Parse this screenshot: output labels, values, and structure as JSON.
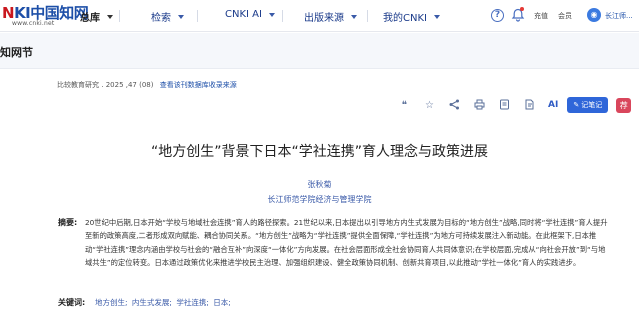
{
  "header": {
    "logo_text": "中国知网",
    "logo_url": "www.cnki.net",
    "zongku_label": "总库",
    "nav": [
      {
        "label": "检索"
      },
      {
        "label": "CNKI AI"
      },
      {
        "label": "出版来源"
      },
      {
        "label": "我的CNKI"
      }
    ],
    "recharge": "充值",
    "member": "会员",
    "user_name": "长江师..."
  },
  "subbar": {
    "title": "知网节"
  },
  "source": {
    "journal": "比较教育研究",
    "issue": "2025 ,47 (08)",
    "link": "查看该刊数据库收录来源"
  },
  "toolbar": {
    "ai_label": "AI",
    "note_label": "记笔记",
    "fav_icon": "bookmark-icon"
  },
  "article": {
    "title": "“地方创生”背景下日本“学社连携”育人理念与政策进展",
    "author": "张秋菊",
    "affiliation": "长江师范学院经济与管理学院",
    "abstract_label": "摘要:",
    "abstract_text": "20世纪中后期,日本开始“学校与地域社会连携”育人的路径探索。21世纪以来,日本提出以引导地方内生式发展为目标的“地方创生”战略,同时将“学社连携”育人提升至新的政策高度,二者形成双向赋能、耦合协同关系。“地方创生”战略为“学社连携”提供全面保障,“学社连携”为地方可持续发展注入新动能。在此框架下,日本推动“学社连携”理念内涵由学校与社会的“融合互补”向深度“一体化”方向发展。在社会层面形成全社会协同育人共同体意识;在学校层面,完成从“向社会开放”到“与地域共生”的定位转变。日本通过政策优化来推进学校民主治理、加强组织建设、健全政策协同机制、创新共育项目,以此推动“学社一体化”育人的实践进步。",
    "keywords_label": "关键词:",
    "keywords": [
      "地方创生;",
      "内生式发展;",
      "学社连携;",
      "日本;"
    ]
  }
}
